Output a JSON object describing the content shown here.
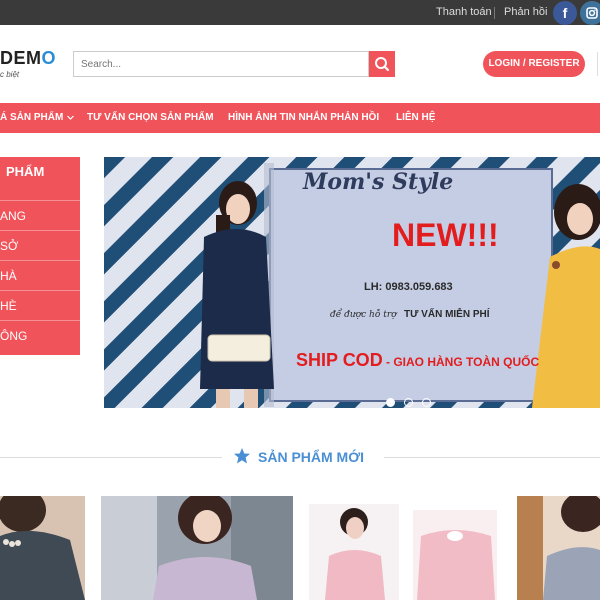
{
  "topbar": {
    "links": [
      "Thanh toán",
      "Phản hồi"
    ],
    "social": [
      {
        "name": "facebook-icon",
        "glyph": "f"
      },
      {
        "name": "instagram-icon",
        "glyph": "◘"
      }
    ]
  },
  "header": {
    "logo_main": "DEM",
    "logo_accent": "O",
    "logo_sub": "c biệt",
    "search_placeholder": "Search...",
    "login_label": "LOGIN / REGISTER"
  },
  "nav": {
    "items": [
      "Á SẢN PHẨM",
      "TƯ VẤN CHỌN SẢN PHẨM",
      "HÌNH ẢNH TIN NHẮN PHẢN HỒI",
      "LIÊN HỆ"
    ]
  },
  "sidebar": {
    "title": "PHẨM",
    "items": [
      "ANG",
      "SỞ",
      "HÀ",
      "HÈ",
      "ÔNG"
    ]
  },
  "banner": {
    "title": "Mom's Style",
    "headline": "NEW!!!",
    "phone": "LH: 0983.059.683",
    "support_prefix": "để được hỗ trợ",
    "support_bold": "TƯ VẤN MIỄN PHÍ",
    "shipping": "SHIP COD",
    "shipping_rest": " - GIAO HÀNG TOÀN QUỐC",
    "slides": 3,
    "active_slide": 1
  },
  "section": {
    "title": "SẢN PHẨM MỚI"
  },
  "colors": {
    "brand": "#f0535a",
    "accent_blue": "#4a8fd4",
    "topbar": "#3a3a3a"
  }
}
